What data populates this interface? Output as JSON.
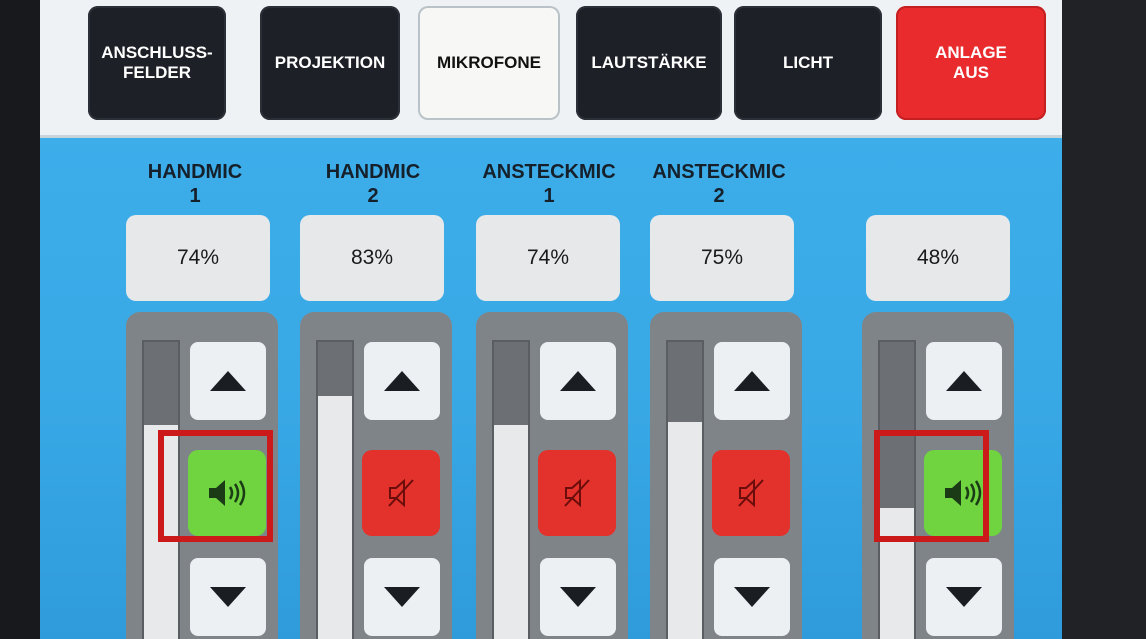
{
  "tabs": [
    {
      "label": "ANSCHLUSS-\nFELDER",
      "state": "normal"
    },
    {
      "label": "PROJEKTION",
      "state": "normal"
    },
    {
      "label": "MIKROFONE",
      "state": "active"
    },
    {
      "label": "LAUTSTÄRKE",
      "state": "normal"
    },
    {
      "label": "LICHT",
      "state": "normal"
    },
    {
      "label": "ANLAGE\nAUS",
      "state": "danger"
    }
  ],
  "channels": [
    {
      "name": "HANDMIC\n1",
      "level_text": "74%",
      "level": 0.74,
      "status": "unmuted",
      "icon": "speaker-on-icon",
      "highlighted": true
    },
    {
      "name": "HANDMIC\n2",
      "level_text": "83%",
      "level": 0.83,
      "status": "muted",
      "icon": "speaker-muted-icon",
      "highlighted": false
    },
    {
      "name": "ANSTECKMIC\n1",
      "level_text": "74%",
      "level": 0.74,
      "status": "muted",
      "icon": "speaker-muted-icon",
      "highlighted": false
    },
    {
      "name": "ANSTECKMIC\n2",
      "level_text": "75%",
      "level": 0.75,
      "status": "muted",
      "icon": "speaker-muted-icon",
      "highlighted": false
    },
    {
      "name": "",
      "level_text": "48%",
      "level": 0.48,
      "status": "unmuted",
      "icon": "speaker-on-icon",
      "highlighted": true
    }
  ],
  "icons": {
    "up": "arrow-up-icon",
    "down": "arrow-down-icon"
  },
  "colors": {
    "background": "#3fb0ec",
    "tab_dark": "#1d2027",
    "tab_active": "#f7f8f6",
    "tab_danger": "#e92b2d",
    "unmuted": "#6fd43f",
    "muted": "#e3312c",
    "highlight": "#cc1a1a"
  }
}
